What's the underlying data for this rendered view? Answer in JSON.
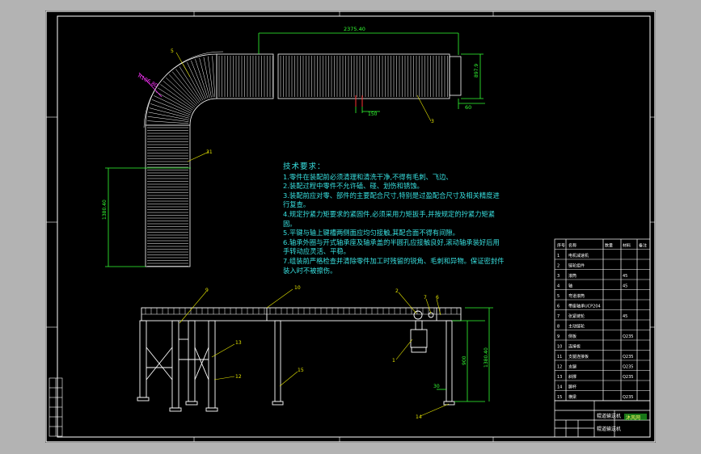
{
  "drawing": {
    "dimensions": {
      "length_top": "2375.40",
      "radius": "R106.80",
      "height_side": "1380.40",
      "small_150": "150",
      "small_60": "60",
      "width_right": "897.9",
      "leg_height": "900",
      "leg_height2": "1380.40",
      "offset_30": "30"
    },
    "balloons": [
      "5",
      "31",
      "3",
      "9",
      "10",
      "2",
      "7",
      "6",
      "13",
      "12",
      "15",
      "1",
      "14"
    ]
  },
  "tech_requirements": {
    "title": "技术要求：",
    "items": [
      "1.零件在装配前必须清理和清洗干净,不得有毛刺、飞边、",
      "2.装配过程中零件不允许磕、碰、划伤和锈蚀。",
      "3.装配前应对零、部件的主要配合尺寸,特别是过盈配合尺寸及相关精度进",
      "行复查。",
      "4.规定拧紧力矩要求的紧固件,必须采用力矩扳手,并按规定的拧紧力矩紧",
      "固。",
      "5.平键与轴上键槽两侧面应均匀接触,其配合面不得有间隙。",
      "6.轴承外圈与开式轴承座及轴承盖的半圆孔应接触良好,滚动轴承装好后用",
      "手转动应灵活、平稳。",
      "7.组装前严格检查并清除零件加工时残留的锐角、毛刺和异物。保证密封件",
      "装入时不被擦伤。"
    ]
  },
  "bom": {
    "header": [
      "序号",
      "名称",
      "数量",
      "材料",
      "备注"
    ],
    "rows": [
      [
        "1",
        "电机减速机",
        "",
        "",
        ""
      ],
      [
        "2",
        "链轮组件",
        "",
        "",
        ""
      ],
      [
        "3",
        "滚筒",
        "",
        "45",
        ""
      ],
      [
        "4",
        "轴",
        "",
        "45",
        ""
      ],
      [
        "5",
        "弯道滚筒",
        "",
        "",
        ""
      ],
      [
        "6",
        "带座轴承UCP204",
        "",
        "",
        ""
      ],
      [
        "7",
        "张紧链轮",
        "",
        "45",
        ""
      ],
      [
        "8",
        "主动链轮",
        "",
        "",
        ""
      ],
      [
        "9",
        "侧板",
        "",
        "Q235",
        ""
      ],
      [
        "10",
        "连接板",
        "",
        "",
        ""
      ],
      [
        "11",
        "支腿连接板",
        "",
        "Q235",
        ""
      ],
      [
        "12",
        "支腿",
        "",
        "Q235",
        ""
      ],
      [
        "13",
        "斜撑",
        "",
        "Q235",
        ""
      ],
      [
        "14",
        "脚杯",
        "",
        "",
        ""
      ],
      [
        "15",
        "横梁",
        "",
        "Q235",
        ""
      ]
    ]
  },
  "title_block": {
    "drawing_name": "辊道输送机",
    "stamp": "沐风网",
    "company": "辊道输送机"
  },
  "colors": {
    "background": "#b3b3b3",
    "sheet": "#000000",
    "lines": "#ffffff",
    "dim_green": "#33ff33",
    "text_cyan": "#38e0e0",
    "magenta": "#ff33ff",
    "yellow": "#e8e800"
  }
}
